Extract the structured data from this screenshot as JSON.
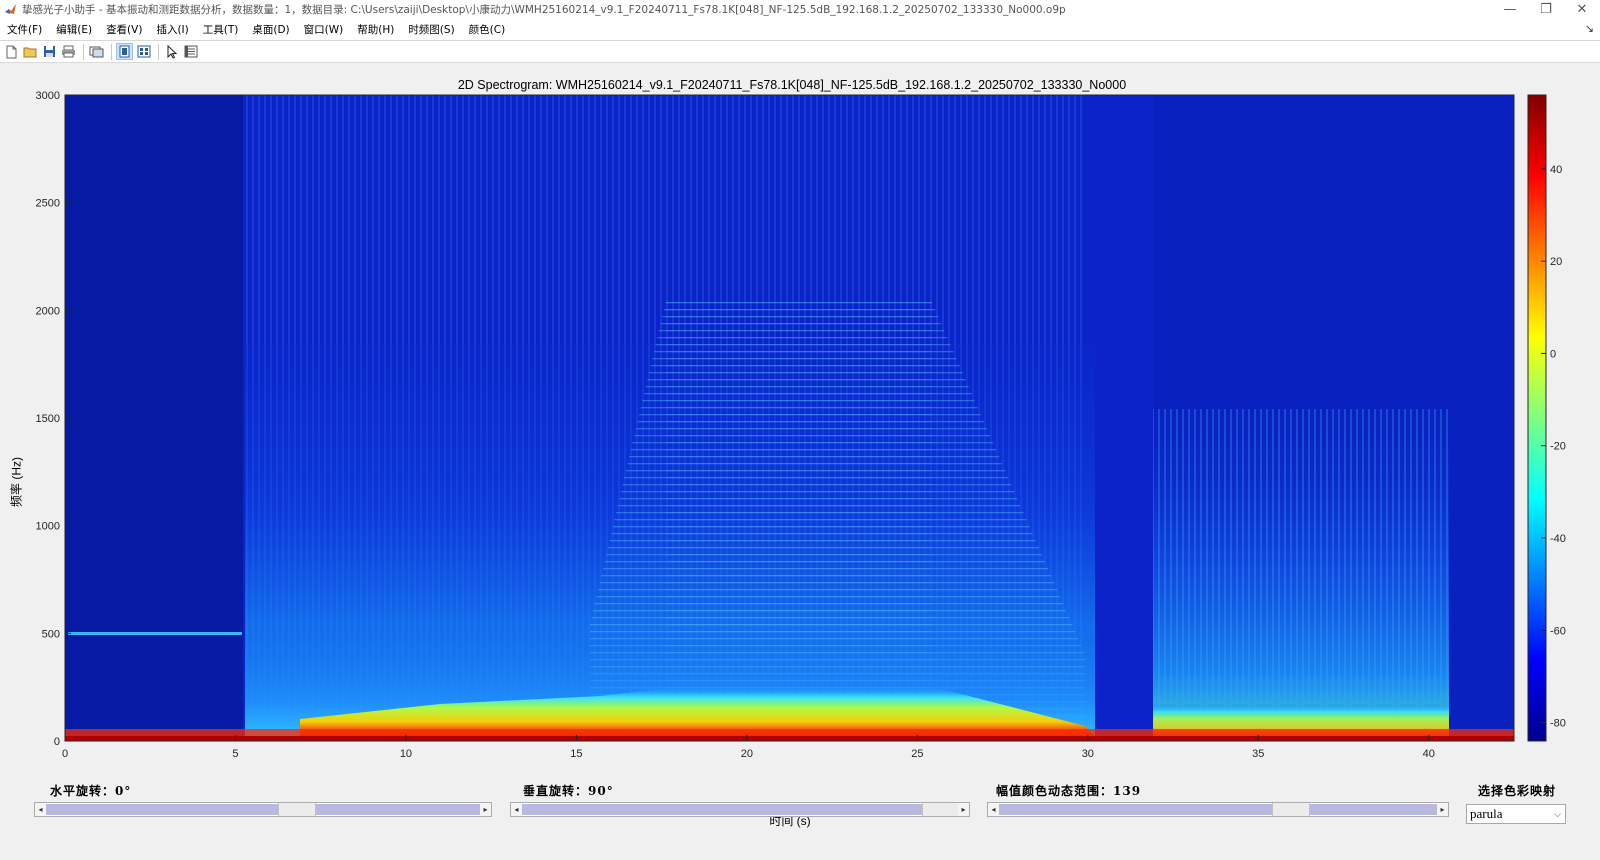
{
  "window": {
    "title": "挚感光子小助手 - 基本振动和测距数据分析，数据数量：1，数据目录: C:\\Users\\zaiji\\Desktop\\小康动力\\WMH25160214_v9.1_F20240711_Fs78.1K[048]_NF-125.5dB_192.168.1.2_20250702_133330_No000.o9p",
    "minimize": "—",
    "maximize": "❐",
    "close": "✕"
  },
  "menu": [
    "文件(F)",
    "编辑(E)",
    "查看(V)",
    "插入(I)",
    "工具(T)",
    "桌面(D)",
    "窗口(W)",
    "帮助(H)",
    "时频图(S)",
    "颜色(C)"
  ],
  "menu_dock": "↘",
  "toolbar_icons": [
    "new-figure-icon",
    "open-folder-icon",
    "save-icon",
    "print-icon",
    "link-figure-icon",
    "plot-tools-hide-icon",
    "plot-tools-show-icon",
    "edit-pointer-icon",
    "property-inspector-icon"
  ],
  "plot": {
    "title": "2D Spectrogram: WMH25160214_v9.1_F20240711_Fs78.1K[048]_NF-125.5dB_192.168.1.2_20250702_133330_No000",
    "xlabel": "时间 (s)",
    "ylabel": "频率 (Hz)",
    "xticks": [
      "0",
      "5",
      "10",
      "15",
      "20",
      "25",
      "30",
      "35",
      "40"
    ],
    "yticks": [
      "0",
      "500",
      "1000",
      "1500",
      "2000",
      "2500",
      "3000"
    ],
    "cbticks": [
      "40",
      "20",
      "0",
      "-20",
      "-40",
      "-60",
      "-80"
    ]
  },
  "chart_data": {
    "type": "heatmap",
    "title": "2D Spectrogram: WMH25160214_v9.1_F20240711_Fs78.1K[048]_NF-125.5dB_192.168.1.2_20250702_133330_No000",
    "xlabel": "时间 (s)",
    "ylabel": "频率 (Hz)",
    "xlim": [
      0,
      42.5
    ],
    "ylim": [
      0,
      3000
    ],
    "clim": [
      -84,
      56
    ],
    "colormap": "jet",
    "colorbar_ticks": [
      40,
      20,
      0,
      -20,
      -40,
      -60,
      -80
    ],
    "features": {
      "tone_500hz": {
        "t_start": 0.2,
        "t_end": 5.2,
        "freq_hz": 500
      },
      "ramp_up": {
        "t_start": 15.5,
        "t_end": 17.8
      },
      "steady": {
        "t_start": 17.8,
        "t_end": 25.3
      },
      "ramp_down": {
        "t_start": 25.3,
        "t_end": 30
      },
      "quiet_gap": {
        "t_start": 30,
        "t_end": 31.8
      },
      "broadband_burst": {
        "t_start": 31.8,
        "t_end": 40.6
      },
      "low_freq_band_hz": [
        0,
        60
      ]
    }
  },
  "controls": {
    "h_rotation_label": "水平旋转：0°",
    "v_rotation_label": "垂直旋转：90°",
    "range_label": "幅值颜色动态范围：139",
    "colormap_label": "选择色彩映射",
    "colormap_value": "parula",
    "h_rotation_value": 0,
    "v_rotation_value": 90,
    "range_value": 139
  }
}
